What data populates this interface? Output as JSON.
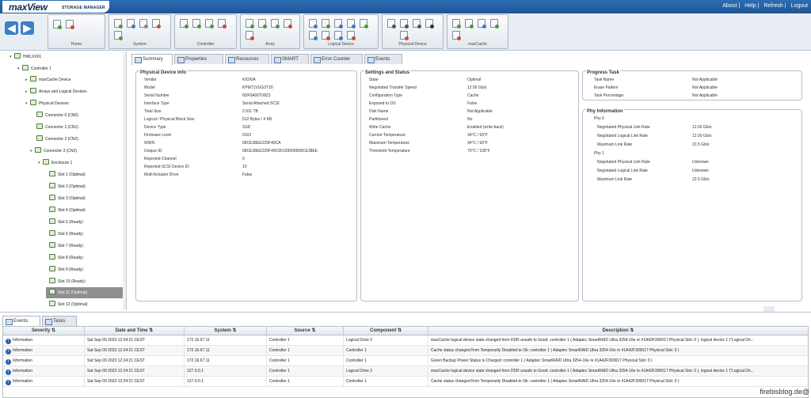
{
  "app": {
    "logo_main": "maxView",
    "logo_sub": "STORAGE MANAGER"
  },
  "top_links": [
    "About",
    "Help",
    "Refresh",
    "Logout"
  ],
  "toolbar_groups": [
    "Home",
    "System",
    "Controller",
    "Array",
    "Logical Device",
    "Physical Device",
    "maxCache"
  ],
  "tree": [
    {
      "label": "HWLXX01",
      "toggle": "▾"
    },
    {
      "label": "Controller 1",
      "toggle": "▾"
    },
    {
      "label": "maxCache Device",
      "toggle": "▸"
    },
    {
      "label": "Arrays and Logical Devices",
      "toggle": "▸"
    },
    {
      "label": "Physical Devices",
      "toggle": "▾"
    },
    {
      "label": "Connector 0 (CN0)",
      "toggle": ""
    },
    {
      "label": "Connector 1 (CN1)",
      "toggle": ""
    },
    {
      "label": "Connector 2 (CN2)",
      "toggle": ""
    },
    {
      "label": "Connector 3 (CN3)",
      "toggle": "▾"
    },
    {
      "label": "Enclosure 1",
      "toggle": "▾"
    },
    {
      "label": "Slot 1 (Optimal)",
      "toggle": ""
    },
    {
      "label": "Slot 2 (Optimal)",
      "toggle": ""
    },
    {
      "label": "Slot 3 (Optimal)",
      "toggle": ""
    },
    {
      "label": "Slot 4 (Optimal)",
      "toggle": ""
    },
    {
      "label": "Slot 5 (Ready)",
      "toggle": ""
    },
    {
      "label": "Slot 6 (Ready)",
      "toggle": ""
    },
    {
      "label": "Slot 7 (Ready)",
      "toggle": ""
    },
    {
      "label": "Slot 8 (Ready)",
      "toggle": ""
    },
    {
      "label": "Slot 9 (Ready)",
      "toggle": ""
    },
    {
      "label": "Slot 10 (Ready)",
      "toggle": ""
    },
    {
      "label": "Slot 11 (Optimal)",
      "toggle": ""
    },
    {
      "label": "Slot 12 (Optimal)",
      "toggle": ""
    }
  ],
  "tabs": [
    "Summary",
    "Properties",
    "Resources",
    "SMART",
    "Error Counter",
    "Events"
  ],
  "physical_device_info": {
    "title": "Physical Device Info",
    "rows": [
      [
        "Vendor",
        "KIOXIA"
      ],
      [
        "Model",
        "KPM71VUG3T20"
      ],
      [
        "Serial Number",
        "6DF0A00T08Z3"
      ],
      [
        "Interface Type",
        "Serial Attached SCSI"
      ],
      [
        "Total Size",
        "2.911 TB"
      ],
      [
        "Logical / Physical Block Size",
        "512 Bytes / 4 KB"
      ],
      [
        "Device Type",
        "SSD"
      ],
      [
        "Firmware Level",
        "0103"
      ],
      [
        "WWN",
        "58CE38EE229F49CA"
      ],
      [
        "Unique ID",
        "58CE38EE229F49C96193000858CE38EE"
      ],
      [
        "Reported Channel",
        "0"
      ],
      [
        "Reported SCSI Device ID",
        "10"
      ],
      [
        "Multi Actuator Drive",
        "False"
      ]
    ]
  },
  "settings_status": {
    "title": "Settings and Status",
    "rows": [
      [
        "State",
        "Optimal"
      ],
      [
        "Negotiated Transfer Speed",
        "12.00 Gb/s"
      ],
      [
        "Configuration Type",
        "Cache"
      ],
      [
        "Exposed to OS",
        "False"
      ],
      [
        "Disk Name",
        "Not Applicable"
      ],
      [
        "Partitioned",
        "No"
      ],
      [
        "Write Cache",
        "Enabled (write-back)"
      ],
      [
        "Current Temperature",
        "34°C / 93°F"
      ],
      [
        "Maximum Temperature",
        "34°C / 93°F"
      ],
      [
        "Threshold Temperature",
        "70°C / 158°F"
      ]
    ]
  },
  "progress_task": {
    "title": "Progress Task",
    "rows": [
      [
        "Task Name",
        "Not Applicable"
      ],
      [
        "Erase Pattern",
        "Not Applicable"
      ],
      [
        "Task Percentage",
        "Not Applicable"
      ]
    ]
  },
  "phy_information": {
    "title": "Phy Information",
    "rows": [
      [
        "Phy 0",
        ""
      ],
      [
        "Negotiated Physical Link Rate",
        "12.00 Gb/s"
      ],
      [
        "Negotiated Logical Link Rate",
        "12.00 Gb/s"
      ],
      [
        "Maximum Link Rate",
        "22.5 Gb/s"
      ],
      [
        "Phy 1",
        ""
      ],
      [
        "Negotiated Physical Link Rate",
        "Unknown"
      ],
      [
        "Negotiated Logical Link Rate",
        "Unknown"
      ],
      [
        "Maximum Link Rate",
        "22.5 Gb/s"
      ]
    ]
  },
  "bottom_tabs": [
    "Events",
    "Tasks"
  ],
  "events": {
    "columns": [
      "Severity",
      "Date and Time",
      "System",
      "Source",
      "Component",
      "Description"
    ],
    "rows": [
      [
        "Information",
        "Sat Sep 09 2023 12:24:21 CEST",
        "172.16.67.11",
        "Controller 1",
        "Logical Drive 2",
        "maxCache logical device state changed from DDR unsafe to Good: controller 1 ( Adaptec SmartRAID Ultra 3254-16e /e #1A42F300017 Physical Slot: 0 ), logical device 1 (\"Logical Dri..."
      ],
      [
        "Information",
        "Sat Sep 09 2023 12:24:21 CEST",
        "172.16.67.11",
        "Controller 1",
        "Controller 1",
        "Cache status changed from Temporarily Disabled to Ok: controller 1 ( Adaptec SmartRAID Ultra 3254-16e /e #1A42F300017 Physical Slot: 0 )"
      ],
      [
        "Information",
        "Sat Sep 09 2023 12:24:21 CEST",
        "172.16.67.11",
        "Controller 1",
        "Controller 1",
        "Green Backup Power Status is Charged: controller 1 ( Adaptec SmartRAID Ultra 3254-16e /e #1A42F300017 Physical Slot: 0 )"
      ],
      [
        "Information",
        "Sat Sep 09 2023 12:24:21 CEST",
        "127.0.0.1",
        "Controller 1",
        "Logical Drive 2",
        "maxCache logical device state changed from DDR unsafe to Good: controller 1 ( Adaptec SmartRAID Ultra 3254-16e /e #1A42F300017 Physical Slot: 0 ), logical device 1 (\"Logical Dri..."
      ],
      [
        "Information",
        "Sat Sep 09 2023 12:24:21 CEST",
        "127.0.0.1",
        "Controller 1",
        "Controller 1",
        "Cache status changed from Temporarily Disabled to Ok: controller 1 ( Adaptec SmartRAID Ultra 3254-16e /e #1A42F300017 Physical Slot: 0 )"
      ]
    ]
  },
  "watermark": "firebisblog.de@"
}
